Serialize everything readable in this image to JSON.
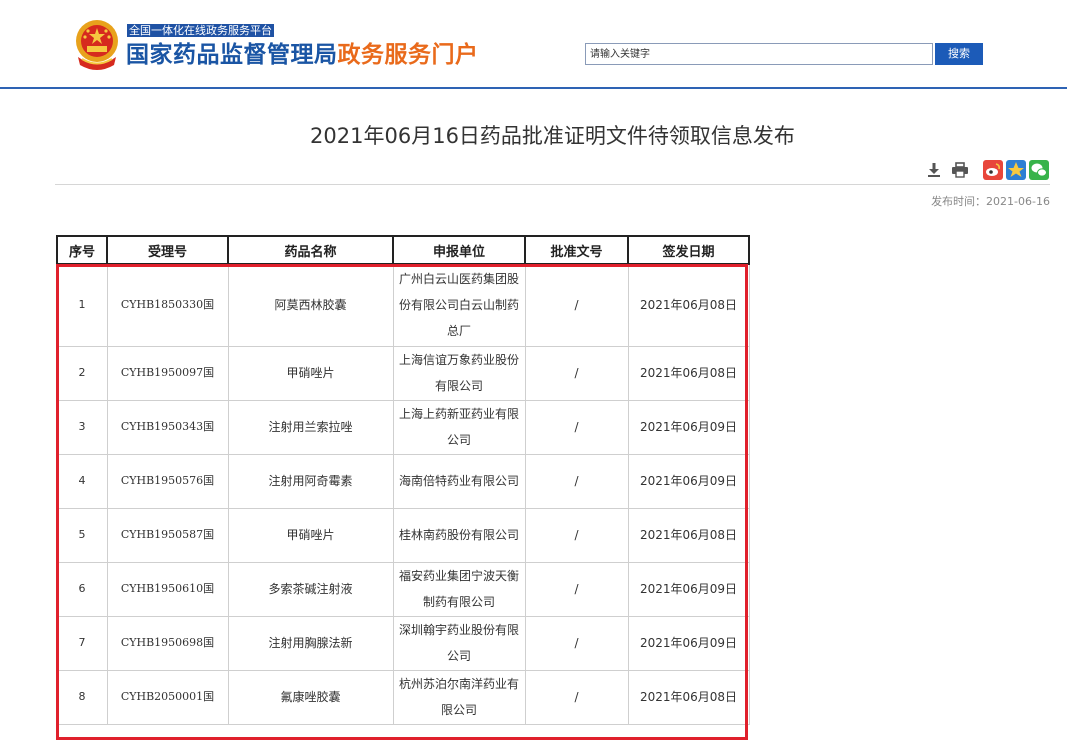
{
  "header": {
    "slogan": "全国一体化在线政务服务平台",
    "site_name_main": "国家药品监督管理局",
    "site_name_suffix": "政务服务门户",
    "search": {
      "placeholder": "请输入关键字",
      "value": ""
    },
    "search_button": "搜索"
  },
  "article": {
    "title": "2021年06月16日药品批准证明文件待领取信息发布",
    "tools": [
      "download-icon",
      "print-icon",
      "weibo-share-icon",
      "qzone-share-icon",
      "wechat-share-icon"
    ],
    "publish_time": "发布时间：2021-06-16"
  },
  "table": {
    "headers": [
      "序号",
      "受理号",
      "药品名称",
      "申报单位",
      "批准文号",
      "签发日期"
    ],
    "rows": [
      [
        "1",
        "CYHB1850330国",
        "阿莫西林胶囊",
        "广州白云山医药集团股份有限公司白云山制药总厂",
        "/",
        "2021年06月08日"
      ],
      [
        "2",
        "CYHB1950097国",
        "甲硝唑片",
        "上海信谊万象药业股份有限公司",
        "/",
        "2021年06月08日"
      ],
      [
        "3",
        "CYHB1950343国",
        "注射用兰索拉唑",
        "上海上药新亚药业有限公司",
        "/",
        "2021年06月09日"
      ],
      [
        "4",
        "CYHB1950576国",
        "注射用阿奇霉素",
        "海南倍特药业有限公司",
        "/",
        "2021年06月09日"
      ],
      [
        "5",
        "CYHB1950587国",
        "甲硝唑片",
        "桂林南药股份有限公司",
        "/",
        "2021年06月08日"
      ],
      [
        "6",
        "CYHB1950610国",
        "多索茶碱注射液",
        "福安药业集团宁波天衡制药有限公司",
        "/",
        "2021年06月09日"
      ],
      [
        "7",
        "CYHB1950698国",
        "注射用胸腺法新",
        "深圳翰宇药业股份有限公司",
        "/",
        "2021年06月09日"
      ],
      [
        "8",
        "CYHB2050001国",
        "氟康唑胶囊",
        "杭州苏泊尔南洋药业有限公司",
        "/",
        "2021年06月08日"
      ]
    ]
  },
  "colors": {
    "brand_blue": "#1a55a4",
    "brand_orange": "#e96a1b",
    "highlight_red": "#e0202c",
    "search_button": "#1c5bb8"
  }
}
